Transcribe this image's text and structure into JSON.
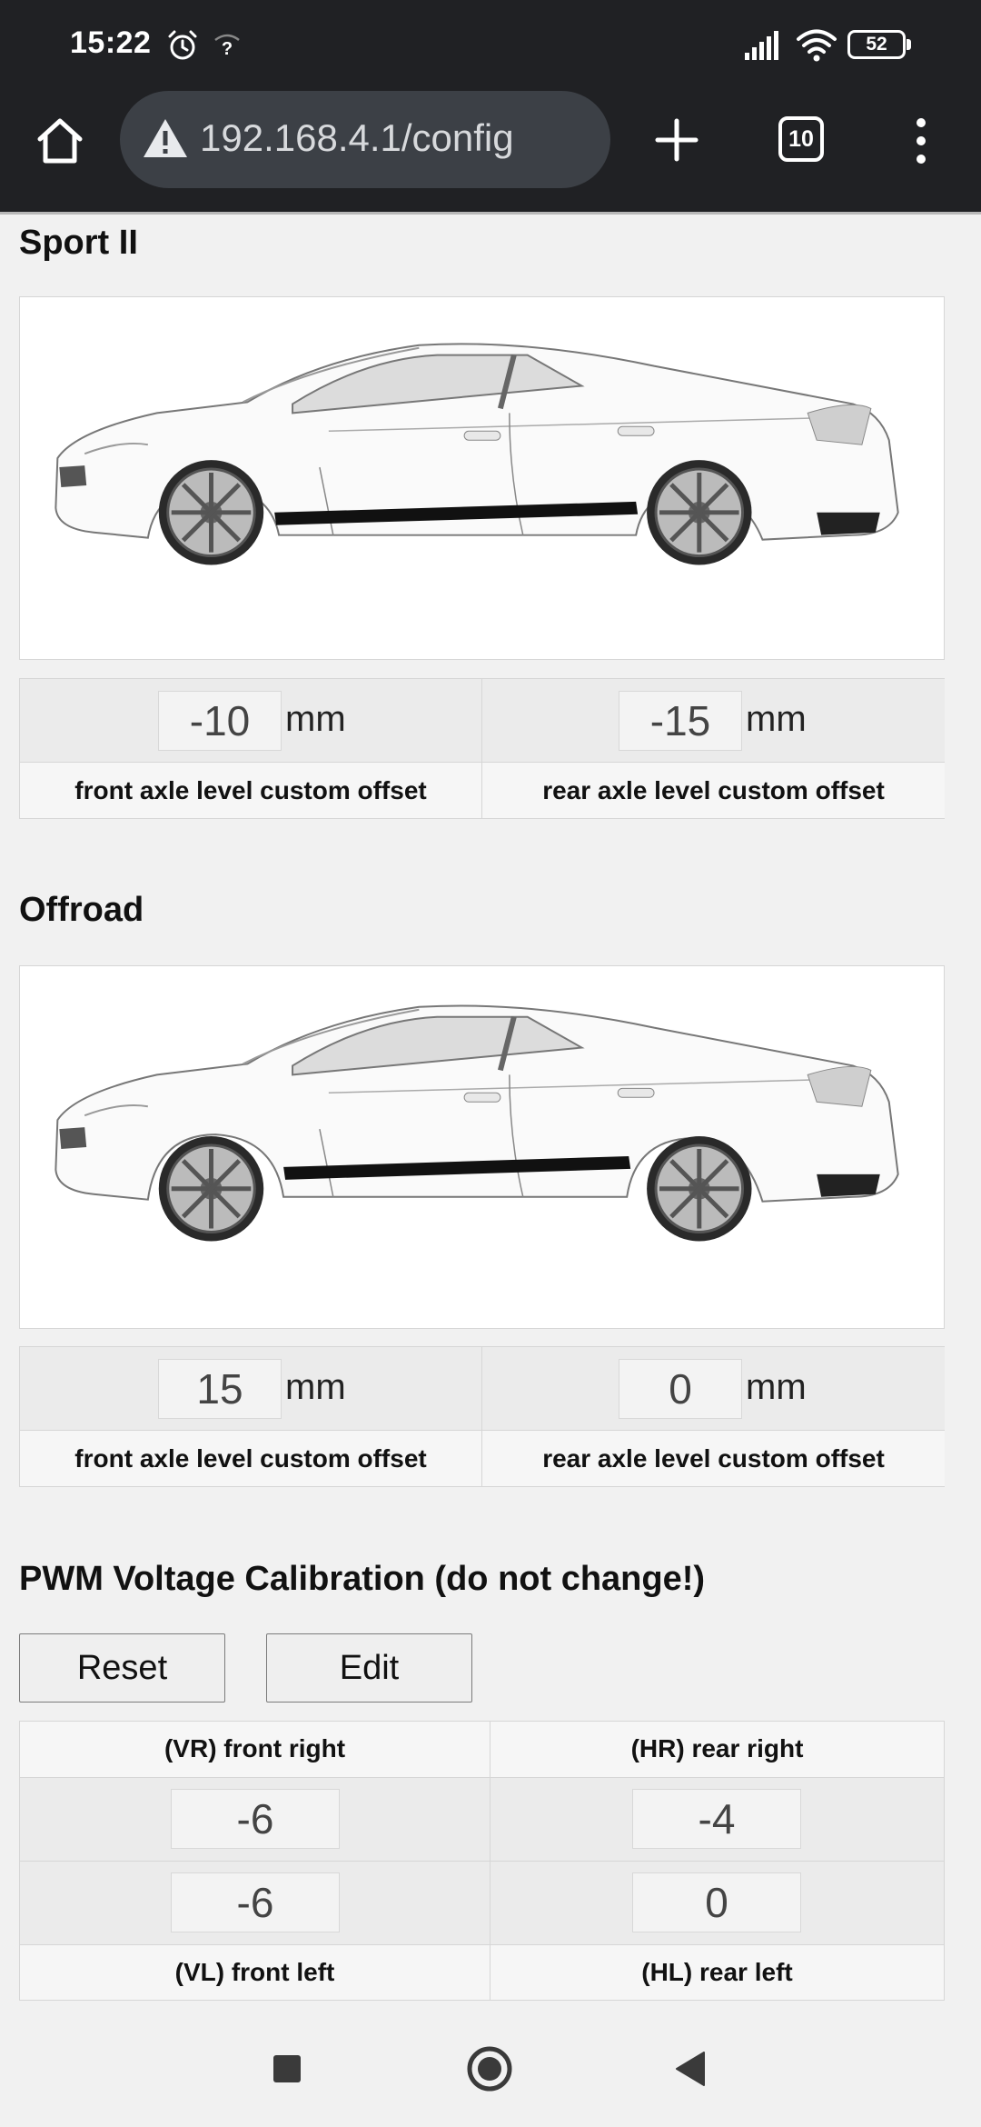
{
  "status_bar": {
    "time": "15:22",
    "battery": "52"
  },
  "browser": {
    "url": "192.168.4.1/config",
    "tab_count": "10"
  },
  "modes": [
    {
      "title": "Sport II",
      "front_value": "-10",
      "rear_value": "-15",
      "unit": "mm",
      "front_label": "front axle level custom offset",
      "rear_label": "rear axle level custom offset"
    },
    {
      "title": "Offroad",
      "front_value": "15",
      "rear_value": "0",
      "unit": "mm",
      "front_label": "front axle level custom offset",
      "rear_label": "rear axle level custom offset"
    }
  ],
  "pwm": {
    "title": "PWM Voltage Calibration (do not change!)",
    "reset_label": "Reset",
    "edit_label": "Edit",
    "header_left": "(VR) front right",
    "header_right": "(HR) rear right",
    "vr_value": "-6",
    "hr_value": "-4",
    "vl_value": "-6",
    "hl_value": "0",
    "footer_left": "(VL) front left",
    "footer_right": "(HL) rear left"
  },
  "icons": {
    "status": [
      "alarm-icon",
      "no-sim-wifi-icon",
      "signal-icon",
      "wifi-icon",
      "battery-icon"
    ],
    "toolbar": [
      "home-icon",
      "warning-icon",
      "new-tab-icon",
      "tab-switcher-icon",
      "menu-icon"
    ],
    "nav": [
      "recents-icon",
      "home-circle-icon",
      "back-icon"
    ]
  },
  "colors": {
    "chrome_bg": "#202124",
    "url_bg": "#3c4046",
    "page_bg": "#f1f1f1"
  }
}
